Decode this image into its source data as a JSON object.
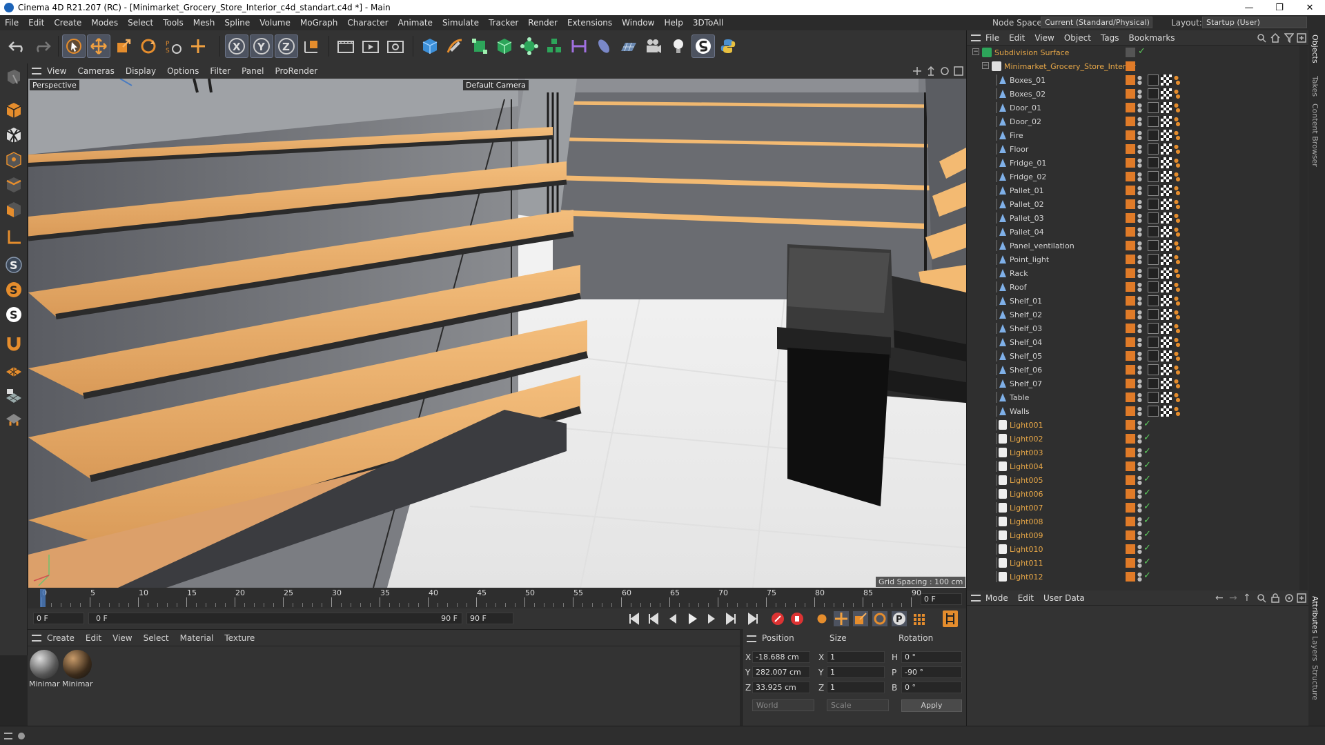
{
  "window": {
    "title": "Cinema 4D R21.207 (RC) - [Minimarket_Grocery_Store_Interior_c4d_standart.c4d *] - Main",
    "minimize": "—",
    "restore": "❐",
    "close": "✕"
  },
  "menu": [
    "File",
    "Edit",
    "Create",
    "Modes",
    "Select",
    "Tools",
    "Mesh",
    "Spline",
    "Volume",
    "MoGraph",
    "Character",
    "Animate",
    "Simulate",
    "Tracker",
    "Render",
    "Extensions",
    "Window",
    "Help",
    "3DToAll"
  ],
  "nodespace": {
    "label": "Node Space:",
    "value": "Current (Standard/Physical)"
  },
  "layout": {
    "label": "Layout:",
    "value": "Startup (User)"
  },
  "viewport": {
    "menu": [
      "View",
      "Cameras",
      "Display",
      "Options",
      "Filter",
      "Panel",
      "ProRender"
    ],
    "label": "Perspective",
    "camera": "Default Camera",
    "grid_spacing": "Grid Spacing : 100 cm"
  },
  "timeline": {
    "ticks": [
      "0",
      "5",
      "10",
      "15",
      "20",
      "25",
      "30",
      "35",
      "40",
      "45",
      "50",
      "55",
      "60",
      "65",
      "70",
      "75",
      "80",
      "85",
      "90"
    ],
    "current_frame": "0 F",
    "start": "0 F",
    "range_start": "0 F",
    "range_end": "90 F",
    "end": "90 F"
  },
  "materials": {
    "menu": [
      "Create",
      "Edit",
      "View",
      "Select",
      "Material",
      "Texture"
    ],
    "items": [
      {
        "label": "Minimar"
      },
      {
        "label": "Minimar"
      }
    ]
  },
  "coords": {
    "headers": {
      "position": "Position",
      "size": "Size",
      "rotation": "Rotation"
    },
    "rows": [
      {
        "axis": "X",
        "pos": "-18.688 cm",
        "saxis": "X",
        "size": "1",
        "raxis": "H",
        "rot": "0 °"
      },
      {
        "axis": "Y",
        "pos": "282.007 cm",
        "saxis": "Y",
        "size": "1",
        "raxis": "P",
        "rot": "-90 °"
      },
      {
        "axis": "Z",
        "pos": "33.925 cm",
        "saxis": "Z",
        "size": "1",
        "raxis": "B",
        "rot": "0 °"
      }
    ],
    "world": "World",
    "scale": "Scale",
    "apply": "Apply"
  },
  "object_manager": {
    "menu": [
      "File",
      "Edit",
      "View",
      "Object",
      "Tags",
      "Bookmarks"
    ],
    "root": "Subdivision Surface",
    "group": "Minimarket_Grocery_Store_Interior",
    "objects": [
      "Boxes_01",
      "Boxes_02",
      "Door_01",
      "Door_02",
      "Fire",
      "Floor",
      "Fridge_01",
      "Fridge_02",
      "Pallet_01",
      "Pallet_02",
      "Pallet_03",
      "Pallet_04",
      "Panel_ventilation",
      "Point_light",
      "Rack",
      "Roof",
      "Shelf_01",
      "Shelf_02",
      "Shelf_03",
      "Shelf_04",
      "Shelf_05",
      "Shelf_06",
      "Shelf_07",
      "Table",
      "Walls"
    ],
    "lights": [
      "Light001",
      "Light002",
      "Light003",
      "Light004",
      "Light005",
      "Light006",
      "Light007",
      "Light008",
      "Light009",
      "Light010",
      "Light011",
      "Light012"
    ]
  },
  "attributes": {
    "menu": [
      "Mode",
      "Edit",
      "User Data"
    ]
  },
  "right_tabs": [
    "Objects",
    "Takes",
    "Content Browser",
    "Attributes",
    "Layers",
    "Structure"
  ],
  "colors": {
    "accent": "#e07b28",
    "light_text": "#e8a848",
    "root_text": "#e8a848",
    "check": "#5cc85c"
  }
}
